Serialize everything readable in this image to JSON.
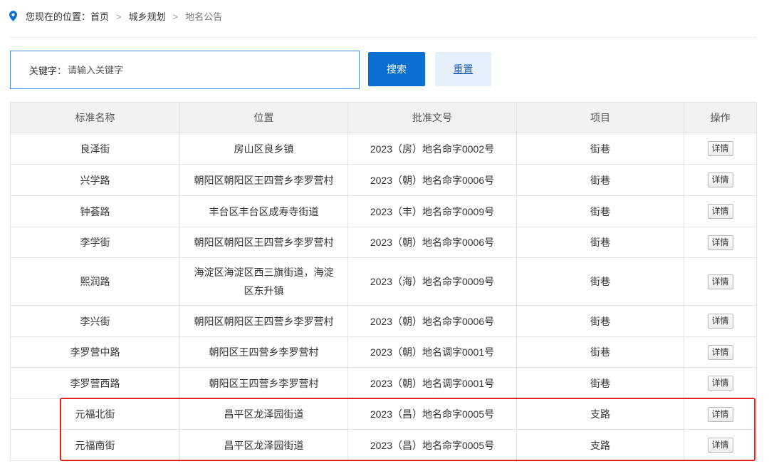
{
  "breadcrumb": {
    "prefix": "您现在的位置：",
    "items": [
      "首页",
      "城乡规划",
      "地名公告"
    ],
    "separator": ">"
  },
  "search": {
    "label": "关键字：",
    "placeholder": "请输入关键字",
    "value": "",
    "search_button": "搜索",
    "reset_button": "重置"
  },
  "table": {
    "columns": [
      "标准名称",
      "位置",
      "批准文号",
      "项目",
      "操作"
    ],
    "detail_button_label": "详情",
    "rows": [
      {
        "name": "良泽街",
        "location": "房山区良乡镇",
        "approval_no": "2023（房）地名命字0002号",
        "category": "街巷"
      },
      {
        "name": "兴学路",
        "location": "朝阳区朝阳区王四营乡李罗营村",
        "approval_no": "2023（朝）地名命字0006号",
        "category": "街巷"
      },
      {
        "name": "钟荟路",
        "location": "丰台区丰台区成寿寺街道",
        "approval_no": "2023（丰）地名命字0009号",
        "category": "街巷"
      },
      {
        "name": "李学街",
        "location": "朝阳区朝阳区王四营乡李罗营村",
        "approval_no": "2023（朝）地名命字0006号",
        "category": "街巷"
      },
      {
        "name": "熙润路",
        "location": "海淀区海淀区西三旗街道，海淀区东升镇",
        "approval_no": "2023（海）地名命字0009号",
        "category": "街巷"
      },
      {
        "name": "李兴街",
        "location": "朝阳区朝阳区王四营乡李罗营村",
        "approval_no": "2023（朝）地名命字0006号",
        "category": "街巷"
      },
      {
        "name": "李罗营中路",
        "location": "朝阳区王四营乡李罗营村",
        "approval_no": "2023（朝）地名调字0001号",
        "category": "街巷"
      },
      {
        "name": "李罗营西路",
        "location": "朝阳区王四营乡李罗营村",
        "approval_no": "2023（朝）地名调字0001号",
        "category": "街巷"
      },
      {
        "name": "元福北街",
        "location": "昌平区龙泽园街道",
        "approval_no": "2023（昌）地名命字0005号",
        "category": "支路"
      },
      {
        "name": "元福南街",
        "location": "昌平区龙泽园街道",
        "approval_no": "2023（昌）地名命字0005号",
        "category": "支路"
      }
    ]
  },
  "icons": {
    "breadcrumb": "location-pin-icon"
  },
  "colors": {
    "accent": "#0b6fcf",
    "reset_bg": "#e6f0fb",
    "reset_text": "#1d5fb0",
    "highlight_border": "#e3211f",
    "header_bg": "#f2f2f2"
  }
}
